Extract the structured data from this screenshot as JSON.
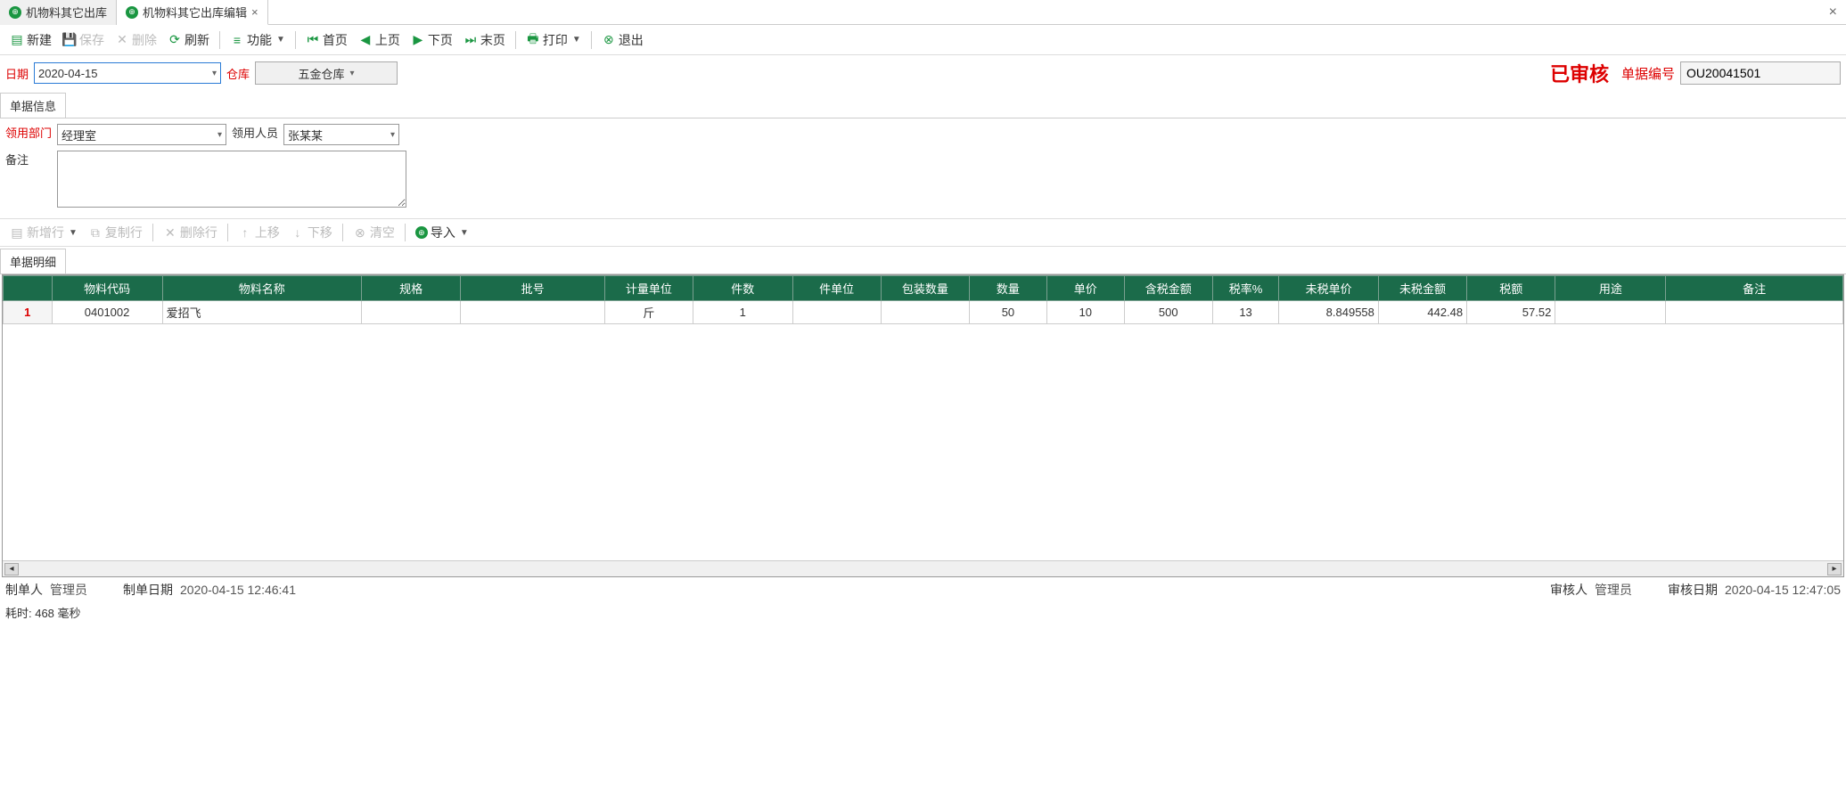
{
  "tabs": [
    {
      "label": "机物料其它出库",
      "active": false
    },
    {
      "label": "机物料其它出库编辑",
      "active": true
    }
  ],
  "toolbar": {
    "new": "新建",
    "save": "保存",
    "delete": "删除",
    "refresh": "刷新",
    "func": "功能",
    "first": "首页",
    "prev": "上页",
    "next": "下页",
    "last": "末页",
    "print": "打印",
    "exit": "退出"
  },
  "header": {
    "date_label": "日期",
    "date_value": "2020-04-15",
    "warehouse_label": "仓库",
    "warehouse_value": "五金仓库",
    "status_stamp": "已审核",
    "docno_label": "单据编号",
    "docno_value": "OU20041501"
  },
  "sect_doc_info": "单据信息",
  "form": {
    "dept_label": "领用部门",
    "dept_value": "经理室",
    "person_label": "领用人员",
    "person_value": "张某某",
    "remark_label": "备注",
    "remark_value": ""
  },
  "grid_toolbar": {
    "addrow": "新增行",
    "copyrow": "复制行",
    "delrow": "删除行",
    "moveup": "上移",
    "movedown": "下移",
    "clear": "清空",
    "import": "导入"
  },
  "sect_detail": "单据明细",
  "grid": {
    "cols": [
      "",
      "物料代码",
      "物料名称",
      "规格",
      "批号",
      "计量单位",
      "件数",
      "件单位",
      "包装数量",
      "数量",
      "单价",
      "含税金额",
      "税率%",
      "未税单价",
      "未税金额",
      "税额",
      "用途",
      "备注"
    ],
    "rows": [
      {
        "n": "1",
        "code": "0401002",
        "name": "爱招飞",
        "spec": "",
        "batch": "",
        "unit": "斤",
        "pcs": "1",
        "pcunit": "",
        "pack": "",
        "qty": "50",
        "price": "10",
        "amt_tax": "500",
        "taxrate": "13",
        "price_notax": "8.849558",
        "amt_notax": "442.48",
        "tax": "57.52",
        "usage": "",
        "remark": ""
      }
    ]
  },
  "footer": {
    "creator_label": "制单人",
    "creator": "管理员",
    "create_date_label": "制单日期",
    "create_date": "2020-04-15 12:46:41",
    "auditor_label": "审核人",
    "auditor": "管理员",
    "audit_date_label": "审核日期",
    "audit_date": "2020-04-15 12:47:05"
  },
  "statusbar": "耗时: 468 毫秒"
}
